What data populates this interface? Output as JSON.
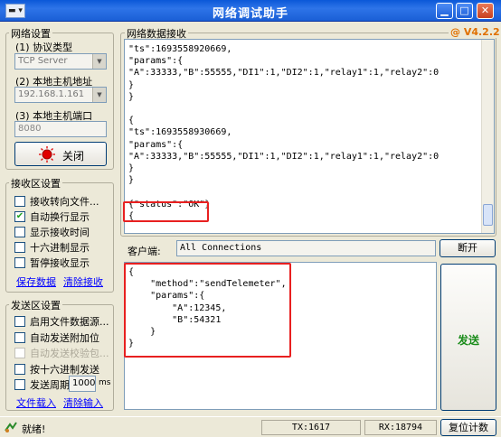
{
  "window": {
    "title": "网络调试助手",
    "sys_icon": "▬ ▾",
    "version": "@ V4.2.2"
  },
  "network": {
    "title": "网络设置",
    "protocol_label": "(1) 协议类型",
    "protocol_value": "TCP Server",
    "host_label": "(2) 本地主机地址",
    "host_value": "192.168.1.161",
    "port_label": "(3) 本地主机端口",
    "port_value": "8080",
    "toggle_label": "关闭"
  },
  "receive": {
    "title": "接收区设置",
    "options": [
      {
        "label": "接收转向文件...",
        "checked": false
      },
      {
        "label": "自动换行显示",
        "checked": true
      },
      {
        "label": "显示接收时间",
        "checked": false
      },
      {
        "label": "十六进制显示",
        "checked": false
      },
      {
        "label": "暂停接收显示",
        "checked": false
      }
    ],
    "save_link": "保存数据",
    "clear_link": "清除接收"
  },
  "send": {
    "title": "发送区设置",
    "options": [
      {
        "label": "启用文件数据源...",
        "checked": false,
        "disabled": false
      },
      {
        "label": "自动发送附加位",
        "checked": false,
        "disabled": false
      },
      {
        "label": "自动发送校验包...",
        "checked": false,
        "disabled": true
      },
      {
        "label": "按十六进制发送",
        "checked": false,
        "disabled": false
      }
    ],
    "period_label": "发送周期",
    "period_value": "1000",
    "period_unit": "ms",
    "load_link": "文件载入",
    "clear_link": "清除输入"
  },
  "main": {
    "receive_title": "网络数据接收",
    "receive_text": "\"ts\":1693558920669,\n\"params\":{\n\"A\":33333,\"B\":55555,\"DI1\":1,\"DI2\":1,\"relay1\":1,\"relay2\":0\n}\n}\n\n{\n\"ts\":1693558930669,\n\"params\":{\n\"A\":33333,\"B\":55555,\"DI1\":1,\"DI2\":1,\"relay1\":1,\"relay2\":0\n}\n}\n\n{\"status\":\"OK\"}\n{",
    "client_label": "客户端:",
    "client_value": "All Connections",
    "disconnect_label": "断开",
    "send_text": "{\n    \"method\":\"sendTelemeter\",\n    \"params\":{\n        \"A\":12345,\n        \"B\":54321\n    }\n}",
    "send_button": "发送"
  },
  "status": {
    "ready": "就绪!",
    "tx": "TX:1617",
    "rx": "RX:18794",
    "reset_label": "复位计数"
  }
}
